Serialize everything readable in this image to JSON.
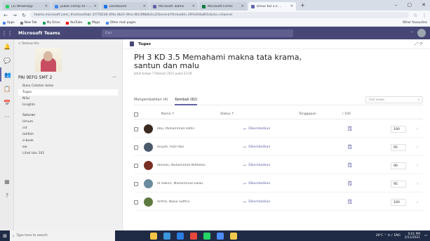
{
  "browser": {
    "tabs": [
      {
        "label": "(2) WhatsApp",
        "color": "#25d366",
        "active": false
      },
      {
        "label": "public.com/p 41 - ...",
        "color": "#4285f4",
        "active": false
      },
      {
        "label": "Dashboard",
        "color": "#1a73e8",
        "active": false
      },
      {
        "label": "Microsoft Teams",
        "color": "#6264a7",
        "active": false
      },
      {
        "label": "Microsoft Forms",
        "color": "#107c41",
        "active": false
      },
      {
        "label": "Unsur KD 3.5 ...",
        "color": "#6264a7",
        "active": true
      }
    ],
    "window_controls": {
      "min": "–",
      "max": "▢",
      "close": "✕"
    },
    "url": "teams.microsoft.com/_#/school/tab::1f778236-4f4a-4b21-9fca-00c3f8b9a1c2/General?threadId=19%3A4a8f3c&ctx=channel",
    "bookmarks": [
      {
        "label": "Apps",
        "color": "#4285f4"
      },
      {
        "label": "New Tab",
        "color": "#777777"
      },
      {
        "label": "My Drive",
        "color": "#0f9d58"
      },
      {
        "label": "YouTube",
        "color": "#ff0000"
      },
      {
        "label": "Maps",
        "color": "#34a853"
      },
      {
        "label": "Other mail pages",
        "color": "#4285f4"
      }
    ],
    "bookmarks_right": "Other favourites"
  },
  "teams": {
    "app_name": "Microsoft Teams",
    "search_placeholder": "Cari",
    "header_dash": "–",
    "rail": [
      "Aktivitas",
      "Obrolan",
      "Tim",
      "Tugas",
      "Kalender",
      "..."
    ],
    "rail_bottom": [
      "Aplikasi",
      "Bantuan"
    ],
    "sidebar": {
      "back_label": "< Semua tim",
      "class_name": "PAI 9EFG SMT 2",
      "class_more": "···",
      "items": [
        "Buku Catatan kelas",
        "Tugas",
        "Nilai",
        "Insights"
      ],
      "section": "Saluran",
      "channels": [
        "Umum",
        "cst",
        "tahfizh",
        "e-book",
        "wa",
        "Lihat lain 101"
      ]
    },
    "main": {
      "header_label": "Tugas",
      "header_icons": "⤢  ⟳",
      "title": "PH 3 KD 3.5 Memahami makna tata krama, santun dan malu",
      "due": "Jatuh tempo 7 Februari 2021 pukul 23.59",
      "tabs": [
        {
          "label": "Mengembalikan (4)",
          "active": false
        },
        {
          "label": "Kembali (82)",
          "active": true
        }
      ],
      "search_placeholder": "Cari siswa",
      "search_icon": "⌕",
      "columns": {
        "name": "Nama ↑",
        "status": "Status ↑",
        "feedback": "Tanggapan",
        "points": "/ 100"
      },
      "rows": [
        {
          "name": "Abu, Muhammad Fathil",
          "status": "Dikembalikan",
          "points": "100",
          "avatar": "#3b2a1f"
        },
        {
          "name": "Aisyah, Putri Nur",
          "status": "Dikembalikan",
          "points": "95",
          "avatar": "#4a5a6b"
        },
        {
          "name": "Akhsan, Muhammad Mifftahul",
          "status": "Dikembalikan",
          "points": "90",
          "avatar": "#7a2e24"
        },
        {
          "name": "Al Hakim, Muhammad Zaidu",
          "status": "Dikembalikan",
          "points": "95",
          "avatar": "#6a8a9e"
        },
        {
          "name": "Arifha, Nailul Saffira",
          "status": "Dikembalikan",
          "points": "100",
          "avatar": "#5f7a3e"
        }
      ]
    }
  },
  "taskbar": {
    "search_placeholder": "Type here to search",
    "apps": [
      "#f4c542",
      "#3a96dd",
      "#2a7de1",
      "#e8463c",
      "#25d366",
      "#4b8bf5",
      "#f2c94c"
    ],
    "time": "9:01 PM",
    "date": "2/11/2021",
    "tray_text": "28°C  ⌃  ⊡  ♪  ENG"
  }
}
